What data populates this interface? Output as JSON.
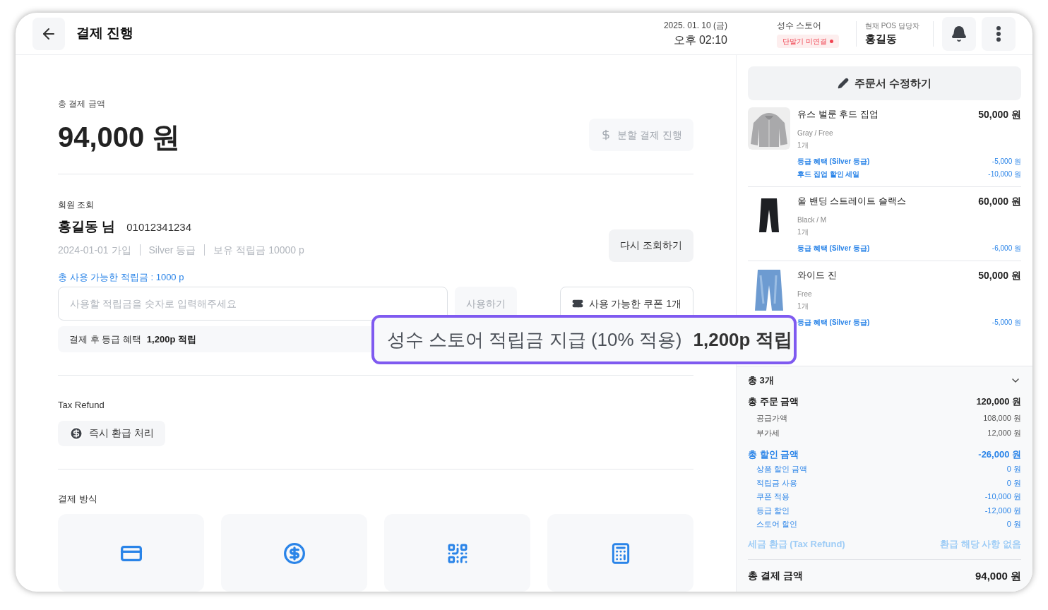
{
  "header": {
    "title": "결제 진행",
    "date": "2025. 01. 10 (금)",
    "time": "오후 02:10",
    "store": "성수 스토어",
    "terminal_status": {
      "label": "단말기 미연결",
      "color": "#f04452"
    },
    "pos_label": "현재 POS 담당자",
    "pos_name": "홍길동"
  },
  "payment": {
    "total_label": "총 결제 금액",
    "total": "94,000 원",
    "split_button": {
      "label": "분할 결제 진행",
      "disabled": true
    }
  },
  "member": {
    "section_label": "회원 조회",
    "name": "홍길동 님",
    "phone": "01012341234",
    "meta": [
      "2024-01-01 가입",
      "Silver 등급",
      "보유 적립금 10000 p"
    ],
    "requery_button": "다시 조회하기",
    "available_points": "총 사용 가능한 적립금 : 1000 p",
    "points_input": {
      "placeholder": "사용할 적립금을 숫자로 입력해주세요"
    },
    "use_button": {
      "label": "사용하기",
      "disabled": true
    },
    "coupon_button": "사용 가능한 쿠폰 1개",
    "benefit_label": "결제 후 등급 혜택",
    "benefit_value": "1,200p 적립"
  },
  "tax_refund": {
    "section_label": "Tax Refund",
    "button": "즉시 환급 처리"
  },
  "payment_methods": {
    "section_label": "결제 방식",
    "methods": [
      {
        "kind": "card"
      },
      {
        "kind": "cash"
      },
      {
        "kind": "qr"
      },
      {
        "kind": "register"
      }
    ]
  },
  "callout": {
    "text": "성수 스토어 적립금 지급 (10% 적용)",
    "value": "1,200p 적립"
  },
  "order": {
    "edit_button": "주문서 수정하기",
    "items": [
      {
        "kind": "hoodie",
        "name": "유스 벌룬 후드 집업",
        "price": "50,000 원",
        "option": "Gray / Free",
        "qty": "1개",
        "discounts": [
          {
            "label": "등급 혜택 (Silver 등급)",
            "amount": "-5,000 원"
          },
          {
            "label": "후드 집업 할인 세일",
            "amount": "-10,000 원"
          }
        ]
      },
      {
        "kind": "slacks",
        "name": "울 밴딩 스트레이트 슬랙스",
        "price": "60,000 원",
        "option": "Black / M",
        "qty": "1개",
        "discounts": [
          {
            "label": "등급 혜택 (Silver 등급)",
            "amount": "-6,000 원"
          }
        ]
      },
      {
        "kind": "jeans",
        "name": "와이드 진",
        "price": "50,000 원",
        "option": "Free",
        "qty": "1개",
        "discounts": [
          {
            "label": "등급 혜택 (Silver 등급)",
            "amount": "-5,000 원"
          }
        ]
      }
    ],
    "count": "총 3개",
    "expanded": false,
    "order_total": {
      "label": "총 주문 금액",
      "value": "120,000 원",
      "rows": [
        {
          "label": "공급가액",
          "value": "108,000 원"
        },
        {
          "label": "부가세",
          "value": "12,000 원"
        }
      ]
    },
    "discount_total": {
      "label": "총 할인 금액",
      "value": "-26,000 원",
      "rows": [
        {
          "label": "상품 할인 금액",
          "value": "0 원"
        },
        {
          "label": "적립금 사용",
          "value": "0 원"
        },
        {
          "label": "쿠폰 적용",
          "value": "-10,000 원"
        },
        {
          "label": "등급 할인",
          "value": "-12,000 원"
        },
        {
          "label": "스토어 할인",
          "value": "0 원"
        }
      ]
    },
    "tax_refund": {
      "label": "세금 환급 (Tax Refund)",
      "value": "환급 해당 사항 없음"
    },
    "grand_total": {
      "label": "총 결제 금액",
      "value": "94,000 원"
    }
  }
}
